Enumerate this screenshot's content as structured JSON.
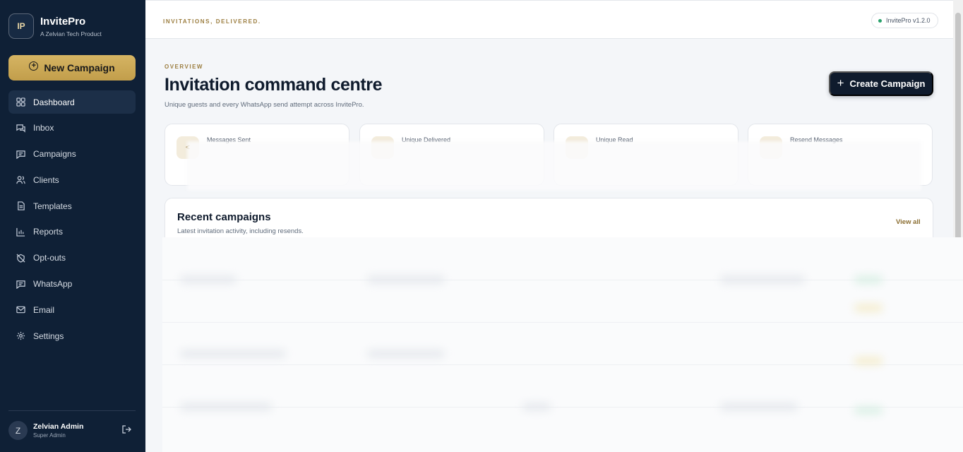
{
  "brand": {
    "logo": "IP",
    "name": "InvitePro",
    "sub": "A Zelvian Tech Product"
  },
  "sidebar": {
    "new_campaign": "New Campaign",
    "items": [
      {
        "label": "Dashboard",
        "icon": "dashboard-icon",
        "active": true
      },
      {
        "label": "Inbox",
        "icon": "inbox-icon"
      },
      {
        "label": "Campaigns",
        "icon": "campaigns-icon"
      },
      {
        "label": "Clients",
        "icon": "clients-icon"
      },
      {
        "label": "Templates",
        "icon": "templates-icon"
      },
      {
        "label": "Reports",
        "icon": "reports-icon"
      },
      {
        "label": "Opt-outs",
        "icon": "opt-outs-icon"
      },
      {
        "label": "WhatsApp",
        "icon": "whatsapp-icon"
      },
      {
        "label": "Email",
        "icon": "email-icon"
      },
      {
        "label": "Settings",
        "icon": "settings-icon"
      }
    ],
    "user": {
      "initial": "Z",
      "name": "Zelvian Admin",
      "role": "Super Admin"
    }
  },
  "topbar": {
    "tagline": "INVITATIONS, DELIVERED.",
    "version": "InvitePro v1.2.0"
  },
  "main": {
    "overview_label": "OVERVIEW",
    "title": "Invitation command centre",
    "subtitle": "Unique guests and every WhatsApp send attempt across InvitePro.",
    "create_button": "Create Campaign",
    "stats": [
      {
        "label": "Messages Sent",
        "icon_glyph": "<"
      },
      {
        "label": "Unique Delivered",
        "icon_glyph": ""
      },
      {
        "label": "Unique Read",
        "icon_glyph": ""
      },
      {
        "label": "Resend Messages",
        "icon_glyph": ""
      }
    ],
    "recent": {
      "title": "Recent campaigns",
      "subtitle": "Latest invitation activity, including resends.",
      "view_all": "View all"
    }
  }
}
